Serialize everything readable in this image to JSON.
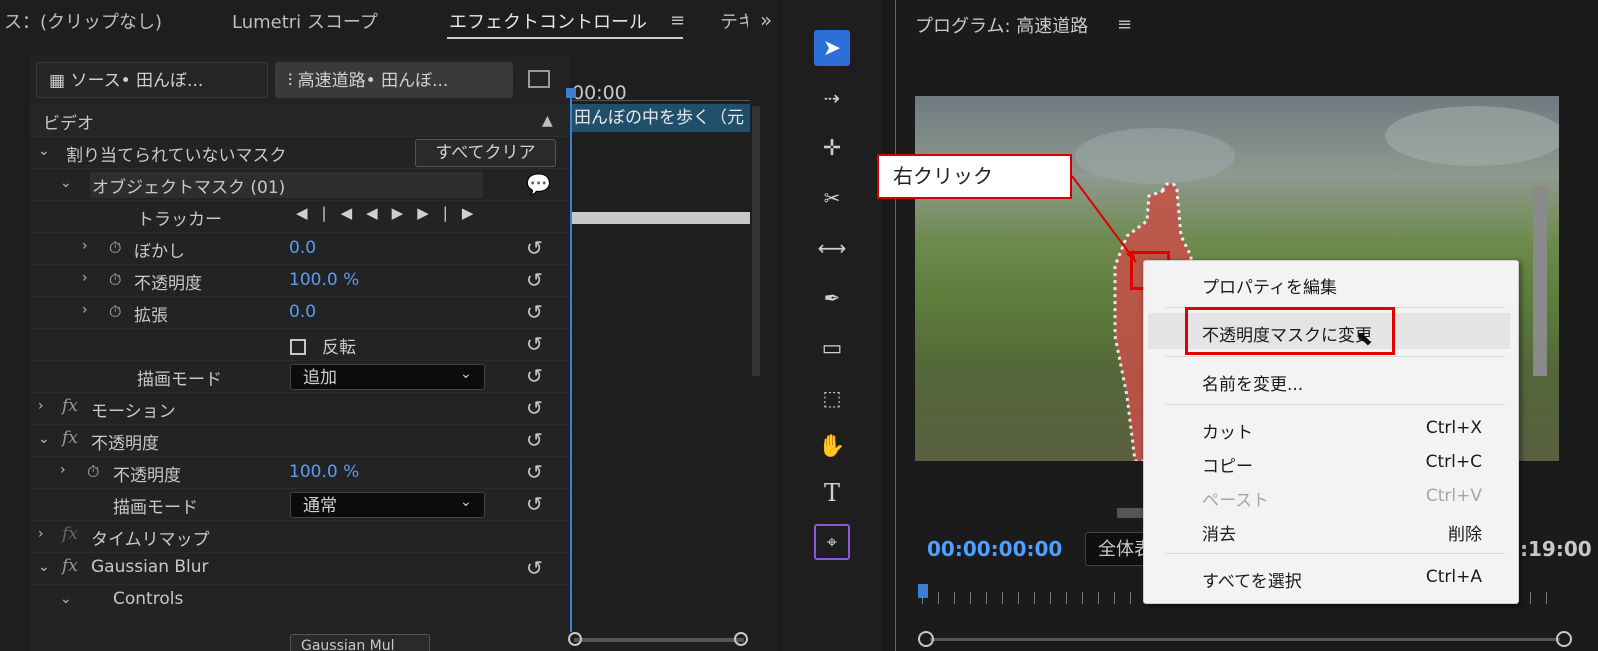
{
  "left_panel": {
    "tabs": [
      {
        "label": "ス：(クリップなし)"
      },
      {
        "label": "Lumetri スコープ"
      },
      {
        "label": "エフェクトコントロール",
        "active": true
      },
      {
        "label": "テキ"
      }
    ],
    "source_button": "ソース• 田んぼ...",
    "sequence_button": "高速道路• 田んぼ...",
    "timeline_timecode": "00:00",
    "clip_label": "田んぼの中を歩く（元",
    "section_video": "ビデオ",
    "unassigned_masks": "割り当てられていないマスク",
    "clear_all": "すべてクリア",
    "object_mask": "オブジェクトマスク (01)",
    "tracker": "トラッカー",
    "feather": {
      "label": "ぼかし",
      "value": "0.0"
    },
    "opacity_mask": {
      "label": "不透明度",
      "value": "100.0 %"
    },
    "expansion": {
      "label": "拡張",
      "value": "0.0"
    },
    "inverted": "反転",
    "blend_mode": {
      "label": "描画モード",
      "value": "追加"
    },
    "motion": "モーション",
    "opacity_section": "不透明度",
    "opacity": {
      "label": "不透明度",
      "value": "100.0 %"
    },
    "opacity_blend": {
      "label": "描画モード",
      "value": "通常"
    },
    "time_remap": "タイムリマップ",
    "gaussian_blur": "Gaussian Blur",
    "controls": "Controls",
    "partial_dropdown": "Gaussian Mul"
  },
  "program": {
    "title": "プログラム: 高速道路",
    "timecode": "00:00:00:00",
    "fit_button": "全体表",
    "end_timecode": ":19:00"
  },
  "callout": "右クリック",
  "context_menu": [
    {
      "label": "プロパティを編集",
      "shortcut": ""
    },
    {
      "label": "不透明度マスクに変更",
      "shortcut": ""
    },
    {
      "label": "名前を変更...",
      "shortcut": ""
    },
    {
      "label": "カット",
      "shortcut": "Ctrl+X"
    },
    {
      "label": "コピー",
      "shortcut": "Ctrl+C"
    },
    {
      "label": "ペースト",
      "shortcut": "Ctrl+V",
      "disabled": true
    },
    {
      "label": "消去",
      "shortcut": "削除"
    },
    {
      "label": "すべてを選択",
      "shortcut": "Ctrl+A"
    }
  ],
  "colors": {
    "accent": "#4ea0ff",
    "highlight": "#e00000",
    "clip": "#1f4f6b"
  }
}
